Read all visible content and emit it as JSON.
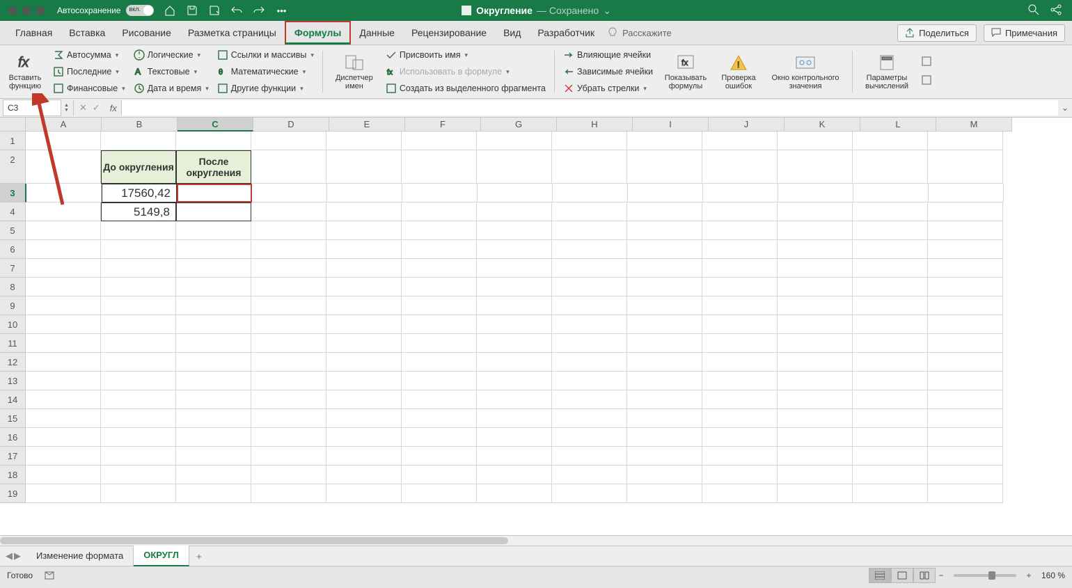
{
  "titlebar": {
    "autosave_label": "Автосохранение",
    "autosave_toggle": "вкл.",
    "doc_name": "Округление",
    "doc_status": "— Сохранено"
  },
  "tabs": {
    "items": [
      "Главная",
      "Вставка",
      "Рисование",
      "Разметка страницы",
      "Формулы",
      "Данные",
      "Рецензирование",
      "Вид",
      "Разработчик"
    ],
    "active_index": 4,
    "tell_me": "Расскажите",
    "share": "Поделиться",
    "comments": "Примечания"
  },
  "ribbon": {
    "insert_fn": "Вставить функцию",
    "col1": [
      "Автосумма",
      "Последние",
      "Финансовые"
    ],
    "col2": [
      "Логические",
      "Текстовые",
      "Дата и время"
    ],
    "col3": [
      "Ссылки и массивы",
      "Математические",
      "Другие функции"
    ],
    "name_mgr": "Диспетчер имен",
    "define": [
      "Присвоить имя",
      "Использовать в формуле",
      "Создать из выделенного фрагмента"
    ],
    "trace": [
      "Влияющие ячейки",
      "Зависимые ячейки",
      "Убрать стрелки"
    ],
    "show_formulas": "Показывать формулы",
    "error_check": "Проверка ошибок",
    "watch": "Окно контрольного значения",
    "calc": "Параметры вычислений"
  },
  "formula_bar": {
    "name_box": "C3",
    "formula": ""
  },
  "grid": {
    "columns": [
      "A",
      "B",
      "C",
      "D",
      "E",
      "F",
      "G",
      "H",
      "I",
      "J",
      "K",
      "L",
      "M"
    ],
    "selected_col_index": 2,
    "row_count": 19,
    "selected_row": 3,
    "headers": {
      "b2": "До округления",
      "c2": "После округления"
    },
    "data": {
      "b3": "17560,42",
      "b4": "5149,8"
    }
  },
  "sheets": {
    "tabs": [
      "Изменение формата",
      "ОКРУГЛ"
    ],
    "active_index": 1,
    "add": "+"
  },
  "status": {
    "ready": "Готово",
    "zoom": "160 %"
  }
}
